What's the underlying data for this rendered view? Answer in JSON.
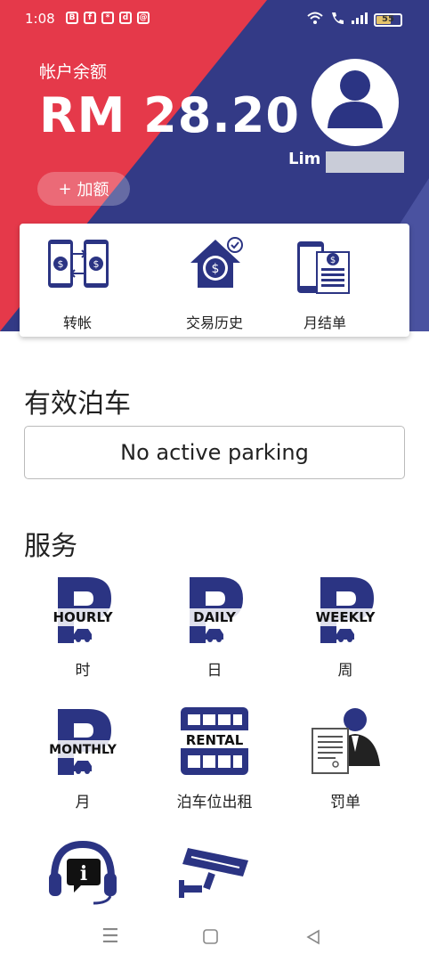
{
  "status_bar": {
    "time": "1:08",
    "app_icons": [
      "B",
      "f",
      "*",
      "d",
      "@"
    ],
    "battery": "55"
  },
  "account": {
    "balance_label": "帐户余额",
    "balance_value": "RM 28.20",
    "top_up_label": "加额",
    "user_name": "Lim"
  },
  "quick_actions": [
    {
      "label": "转帐",
      "icon": "transfer-icon"
    },
    {
      "label": "交易历史",
      "icon": "transaction-history-icon"
    },
    {
      "label": "月结单",
      "icon": "monthly-statement-icon"
    }
  ],
  "active_parking": {
    "title": "有效泊车",
    "empty_text": "No active parking"
  },
  "services": {
    "title": "服务",
    "items": [
      {
        "label": "时",
        "badge": "HOURLY",
        "icon": "parking-p-icon"
      },
      {
        "label": "日",
        "badge": "DAILY",
        "icon": "parking-p-icon"
      },
      {
        "label": "周",
        "badge": "WEEKLY",
        "icon": "parking-p-icon"
      },
      {
        "label": "月",
        "badge": "MONTHLY",
        "icon": "parking-p-icon"
      },
      {
        "label": "泊车位出租",
        "badge": "RENTAL",
        "icon": "rental-icon"
      },
      {
        "label": "罚单",
        "badge": "",
        "icon": "summons-icon"
      },
      {
        "label": "",
        "badge": "",
        "icon": "support-icon"
      },
      {
        "label": "",
        "badge": "",
        "icon": "cctv-icon"
      }
    ]
  },
  "colors": {
    "brand_navy": "#333a86",
    "brand_red": "#e5394a",
    "icon_navy": "#2b3483"
  }
}
